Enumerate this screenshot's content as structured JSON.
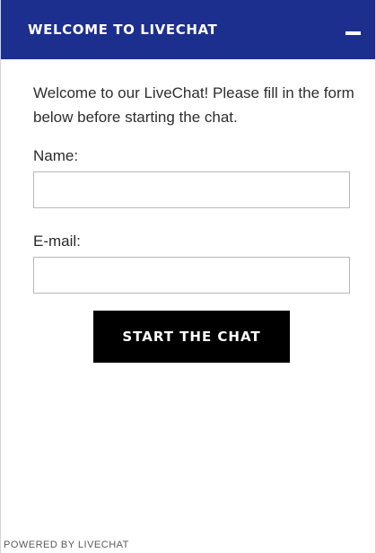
{
  "header": {
    "title": "WELCOME TO LIVECHAT",
    "minimize_icon": "minimize-icon"
  },
  "intro": {
    "text": "Welcome to our LiveChat! Please fill in the form below before starting the chat."
  },
  "form": {
    "name_label": "Name:",
    "name_value": "",
    "email_label": "E-mail:",
    "email_value": ""
  },
  "start_button": {
    "label": "START THE CHAT"
  },
  "footer": {
    "powered_by": "POWERED BY LIVECHAT"
  },
  "colors": {
    "header_bg": "#1c2f8f",
    "button_bg": "#000000"
  }
}
